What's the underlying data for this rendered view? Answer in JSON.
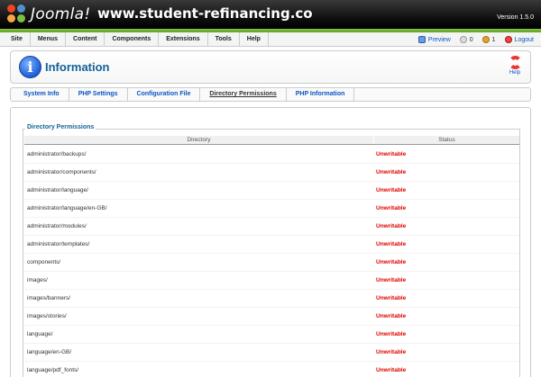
{
  "header": {
    "logo_text": "Joomla!",
    "site_name": "www.student-refinancing.co",
    "version": "Version 1.5.0"
  },
  "menu": {
    "items": [
      "Site",
      "Menus",
      "Content",
      "Components",
      "Extensions",
      "Tools",
      "Help"
    ],
    "right": {
      "preview": "Preview",
      "messages_count": "0",
      "users_count": "1",
      "logout": "Logout"
    }
  },
  "toolbar": {
    "title": "Information",
    "help_label": "Help"
  },
  "tabs": {
    "system_info": "System Info",
    "php_settings": "PHP Settings",
    "config_file": "Configuration File",
    "dir_permissions": "Directory Permissions",
    "php_info": "PHP Information"
  },
  "permissions": {
    "legend": "Directory Permissions",
    "col_directory": "Directory",
    "col_status": "Status",
    "status_color": "#e00000",
    "rows": [
      {
        "dir": "administrator/backups/",
        "status": "Unwritable"
      },
      {
        "dir": "administrator/components/",
        "status": "Unwritable"
      },
      {
        "dir": "administrator/language/",
        "status": "Unwritable"
      },
      {
        "dir": "administrator/language/en-GB/",
        "status": "Unwritable"
      },
      {
        "dir": "administrator/modules/",
        "status": "Unwritable"
      },
      {
        "dir": "administrator/templates/",
        "status": "Unwritable"
      },
      {
        "dir": "components/",
        "status": "Unwritable"
      },
      {
        "dir": "images/",
        "status": "Unwritable"
      },
      {
        "dir": "images/banners/",
        "status": "Unwritable"
      },
      {
        "dir": "images/stories/",
        "status": "Unwritable"
      },
      {
        "dir": "language/",
        "status": "Unwritable"
      },
      {
        "dir": "language/en-GB/",
        "status": "Unwritable"
      },
      {
        "dir": "language/pdf_fonts/",
        "status": "Unwritable"
      }
    ]
  }
}
